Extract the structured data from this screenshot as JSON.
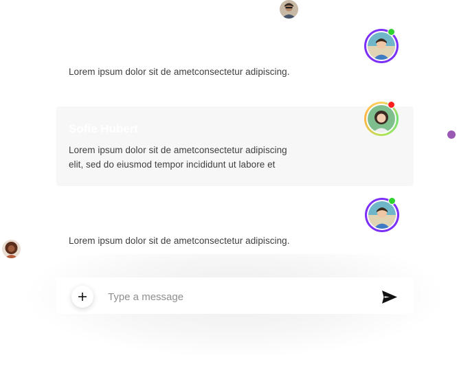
{
  "colors": {
    "accent_purple": "#9b59b6",
    "ring_purple": "#7b2ff7",
    "status_online": "#2ed12e",
    "status_busy": "#ff1e1e",
    "card_bg": "#f7f7f7"
  },
  "floating_avatars": [
    {
      "name": "top-avatar",
      "icon": "person-avatar"
    },
    {
      "name": "left-avatar",
      "icon": "person-avatar"
    }
  ],
  "messages": [
    {
      "text": "Lorem ipsum dolor sit de ametconsectetur adipiscing.",
      "avatar_status": "online",
      "ring": "purple"
    },
    {
      "sender": "Sofie Hubert",
      "text_line1": "Lorem ipsum dolor sit de ametconsectetur adipiscing",
      "text_line2": "elit, sed do eiusmod tempor incididunt ut labore et",
      "avatar_status": "busy",
      "ring": "gradient"
    },
    {
      "text": "Lorem ipsum dolor sit de ametconsectetur adipiscing.",
      "avatar_status": "online",
      "ring": "purple"
    }
  ],
  "composer": {
    "add_icon": "plus-icon",
    "placeholder": "Type a message",
    "value": "",
    "send_icon": "send-icon"
  }
}
